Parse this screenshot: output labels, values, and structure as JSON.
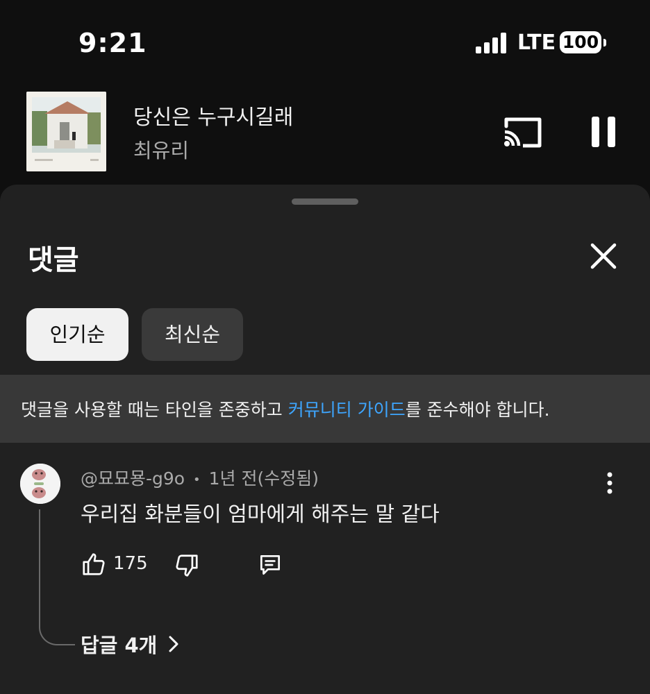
{
  "status_bar": {
    "time": "9:21",
    "network": "LTE",
    "battery": "100"
  },
  "mini_player": {
    "title": "당신은 누구시길래",
    "artist": "최유리",
    "cast_icon": "cast-icon",
    "pause_icon": "pause-icon"
  },
  "comments_sheet": {
    "title": "댓글",
    "close_icon": "close-icon",
    "sort_chips": [
      "인기순",
      "최신순"
    ],
    "selected_chip": "인기순",
    "guideline": {
      "prefix": "댓글을 사용할 때는 타인을 존중하고 ",
      "link": "커뮤니티 가이드",
      "suffix": "를 준수해야 합니다."
    }
  },
  "comment": {
    "author": "@묘묘묭-g9o",
    "separator": "•",
    "time": "1년 전(수정됨)",
    "text": "우리집 화분들이 엄마에게 해주는 말 같다",
    "likes": "175",
    "replies_label": "답글 4개"
  },
  "colors": {
    "background": "#0f0f0f",
    "sheet": "#212121",
    "link": "#3ea6ff",
    "secondary_text": "#aaaaaa"
  }
}
